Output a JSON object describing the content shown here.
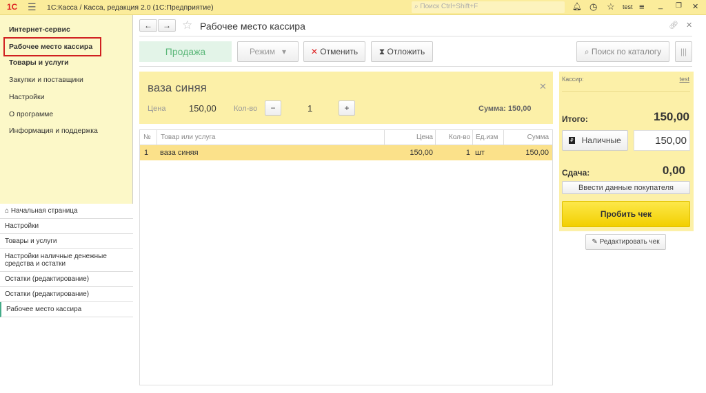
{
  "titlebar": {
    "app_title": "1С:Касса / Касса, редакция 2.0  (1С:Предприятие)",
    "search_placeholder": "Поиск Ctrl+Shift+F",
    "user": "test"
  },
  "sidebar": {
    "sections": [
      "Интернет-сервис",
      "Рабочее место кассира",
      "Товары и услуги",
      "Закупки и поставщики",
      "Настройки",
      "О программе",
      "Информация и поддержка"
    ],
    "history": [
      "Начальная страница",
      "Настройки",
      "Товары и услуги",
      "Настройки наличные денежные средства и остатки",
      "Остатки (редактирование)",
      "Остатки (редактирование)",
      "Рабочее место кассира"
    ]
  },
  "form": {
    "title": "Рабочее место кассира",
    "sale": "Продажа",
    "mode": "Режим",
    "cancel": "Отменить",
    "postpone": "Отложить",
    "catalog_search": "Поиск по каталогу"
  },
  "item": {
    "name": "ваза синяя",
    "price_label": "Цена",
    "price": "150,00",
    "qty_label": "Кол-во",
    "qty": "1",
    "sum": "Сумма: 150,00"
  },
  "table": {
    "headers": [
      "№",
      "Товар или услуга",
      "Цена",
      "Кол-во",
      "Ед.изм",
      "Сумма"
    ],
    "rows": [
      [
        "1",
        "ваза синяя",
        "150,00",
        "1",
        "шт",
        "150,00"
      ]
    ]
  },
  "panel": {
    "cashier_label": "Кассир:",
    "cashier": "test",
    "total_label": "Итого:",
    "total": "150,00",
    "cash": "Наличные",
    "cash_amount": "150,00",
    "change_label": "Сдача:",
    "change": "0,00",
    "buyer": "Ввести данные покупателя",
    "print": "Пробить чек",
    "edit": "Редактировать чек"
  }
}
